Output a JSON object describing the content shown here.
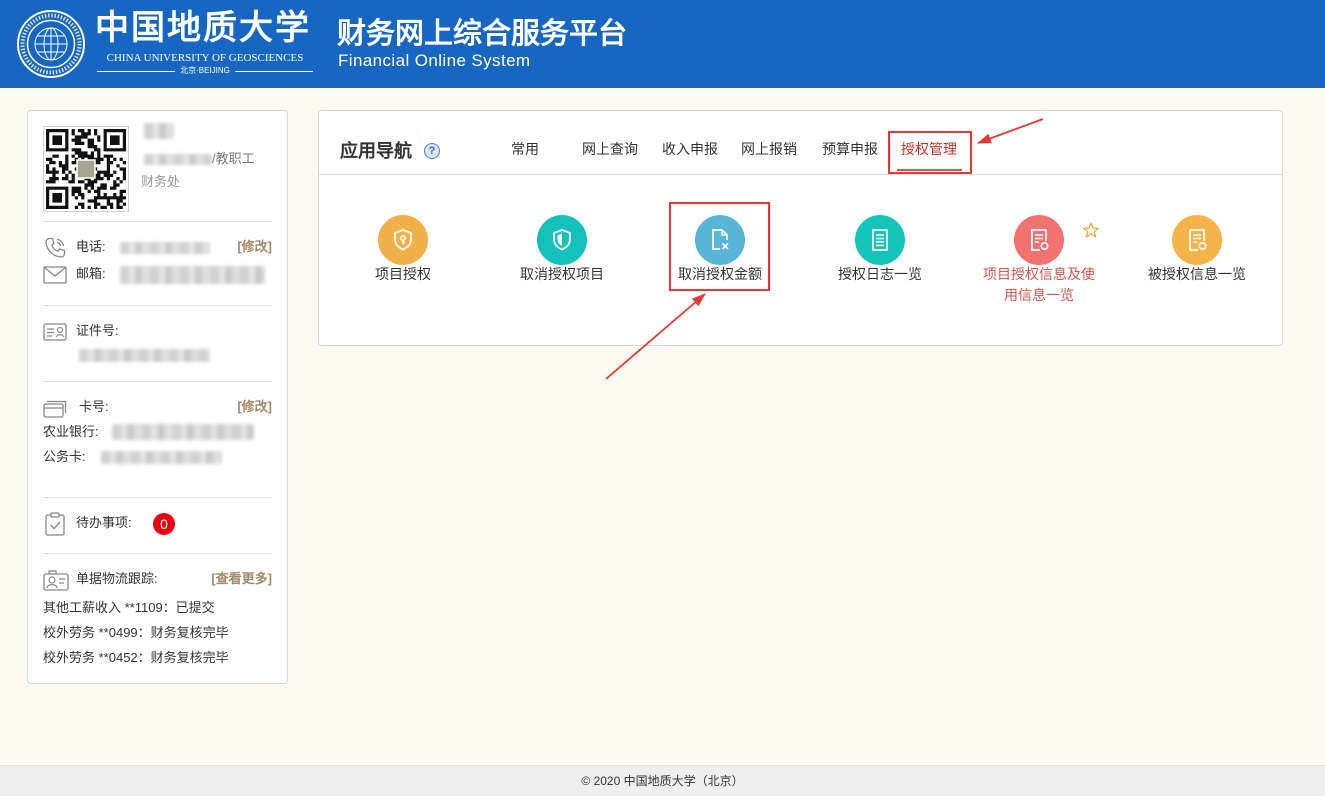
{
  "header": {
    "university_cn": "中国地质大学",
    "university_en": "CHINA UNIVERSITY OF GEOSCIENCES",
    "campus": "北京·BEIJING",
    "system_cn": "财务网上综合服务平台",
    "system_en": "Financial Online System"
  },
  "profile": {
    "role_suffix": "/教职工",
    "department": "财务处",
    "phone_label": "电话:",
    "phone_edit": "[修改]",
    "email_label": "邮箱:",
    "id_label": "证件号:",
    "card_label": "卡号:",
    "card_edit": "[修改]",
    "bank_label": "农业银行:",
    "official_card_label": "公务卡:",
    "todo_label": "待办事项:",
    "todo_count": "0",
    "tracking_label": "单据物流跟踪:",
    "more_label": "[查看更多]",
    "tracking_items": [
      "其他工薪收入 **1109：已提交",
      "校外劳务 **0499：财务复核完毕",
      "校外劳务 **0452：财务复核完毕"
    ]
  },
  "nav": {
    "title": "应用导航",
    "help": "?",
    "tabs": [
      "常用",
      "网上查询",
      "收入申报",
      "网上报销",
      "预算申报",
      "授权管理"
    ],
    "active_tab_index": 5,
    "apps": [
      {
        "label": "项目授权",
        "color": "#f2b04a",
        "icon": "shield-key-icon",
        "label_color": "#333333"
      },
      {
        "label": "取消授权项目",
        "color": "#14c2bb",
        "icon": "shield-half-icon",
        "label_color": "#333333"
      },
      {
        "label": "取消授权金额",
        "color": "#5ab6d8",
        "icon": "document-cancel-icon",
        "label_color": "#333333"
      },
      {
        "label": "授权日志一览",
        "color": "#15c5bc",
        "icon": "document-list-icon",
        "label_color": "#333333"
      },
      {
        "label": "项目授权信息及使用信息一览",
        "color": "#f27272",
        "icon": "document-info-icon",
        "label_color": "#d9534f",
        "starred": true
      },
      {
        "label": "被授权信息一览",
        "color": "#f5b349",
        "icon": "document-info-icon",
        "label_color": "#333333"
      }
    ]
  },
  "footer": {
    "copyright": "© 2020 中国地质大学（北京）"
  },
  "colors": {
    "header_bg": "#1766c1",
    "accent_red": "#c9302c",
    "edit_link": "#a38b6a",
    "badge_red": "#e60012",
    "annotation_red": "#e53935"
  }
}
